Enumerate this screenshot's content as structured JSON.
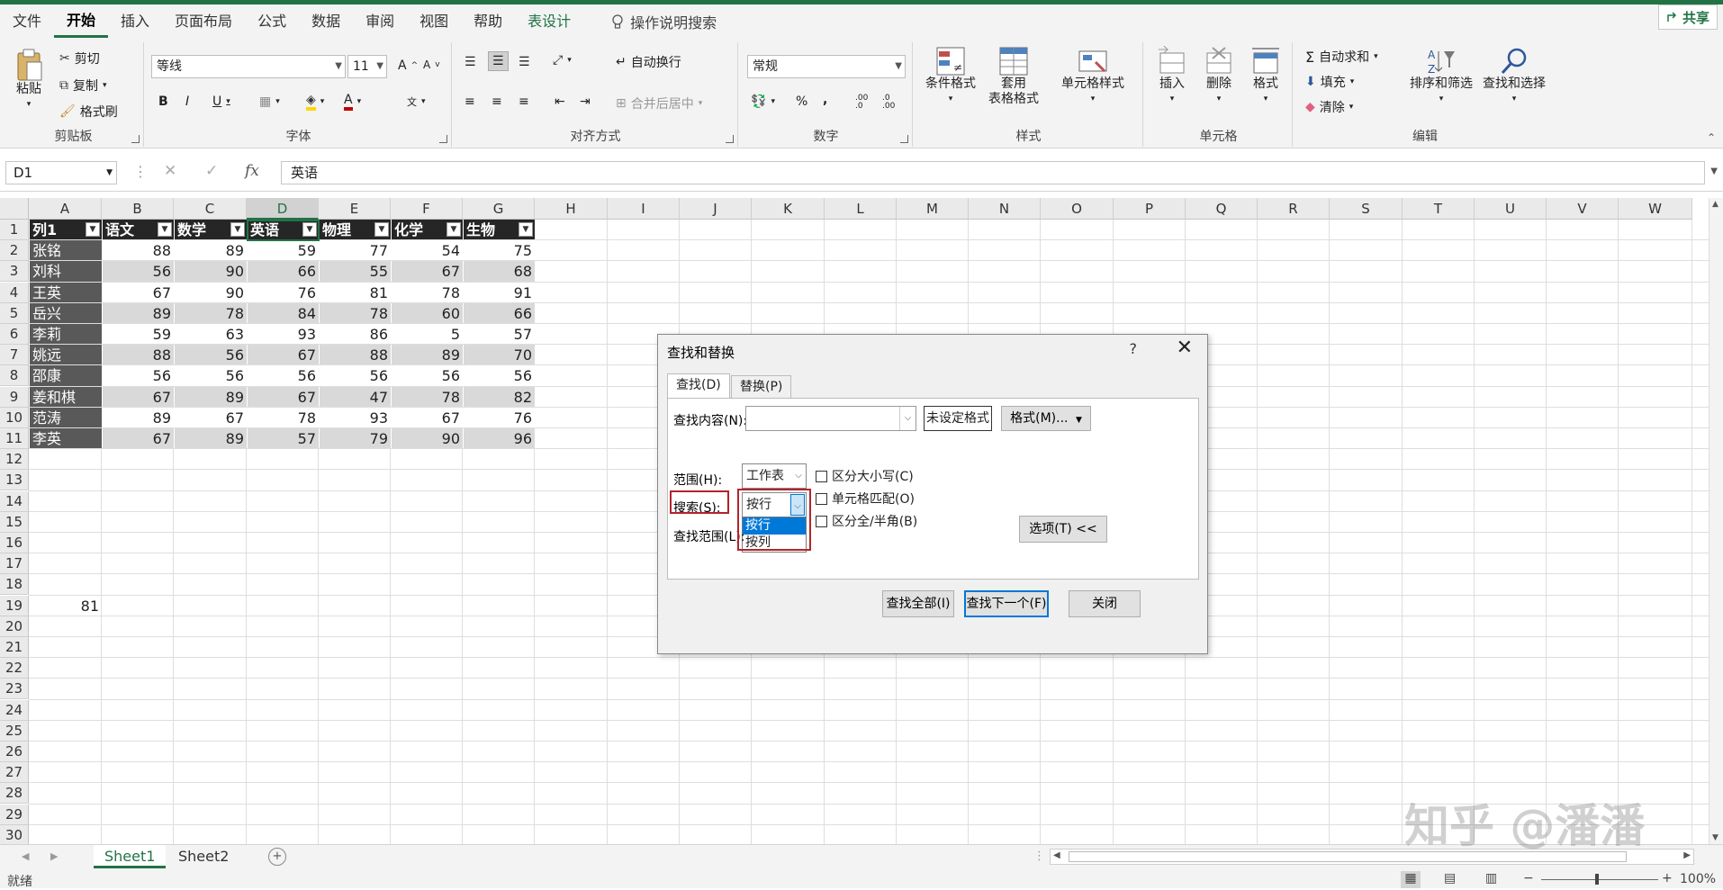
{
  "menu": {
    "items": [
      "文件",
      "开始",
      "插入",
      "页面布局",
      "公式",
      "数据",
      "审阅",
      "视图",
      "帮助",
      "表设计"
    ],
    "active": "开始",
    "tellme": "操作说明搜索",
    "share": "共享"
  },
  "ribbon": {
    "clipboard": {
      "label": "剪贴板",
      "paste": "粘贴",
      "cut": "剪切",
      "copy": "复制",
      "format_painter": "格式刷"
    },
    "font": {
      "label": "字体",
      "font_name": "等线",
      "font_size": "11",
      "bold": "B",
      "italic": "I",
      "underline": "U",
      "grow": "A",
      "shrink": "A",
      "font_color_letter": "A",
      "phonetic": "文"
    },
    "alignment": {
      "label": "对齐方式",
      "wrap": "自动换行",
      "merge": "合并后居中"
    },
    "number": {
      "label": "数字",
      "format": "常规",
      "percent": "%",
      "comma": ",",
      "inc_dec": ".00 .0",
      "dec_dec": ".0 .00"
    },
    "styles": {
      "label": "样式",
      "conditional": "条件格式",
      "table_format_1": "套用",
      "table_format_2": "表格格式",
      "cell_styles": "单元格样式"
    },
    "cells": {
      "label": "单元格",
      "insert": "插入",
      "delete": "删除",
      "format": "格式"
    },
    "editing": {
      "label": "编辑",
      "autosum": "自动求和",
      "fill": "填充",
      "clear": "清除",
      "sort": "排序和筛选",
      "find": "查找和选择"
    }
  },
  "formula_bar": {
    "name_box": "D1",
    "fx": "fx",
    "value": "英语"
  },
  "columns": [
    "A",
    "B",
    "C",
    "D",
    "E",
    "F",
    "G",
    "H",
    "I",
    "J",
    "K",
    "L",
    "M",
    "N",
    "O",
    "P",
    "Q",
    "R",
    "S",
    "T",
    "U",
    "V",
    "W"
  ],
  "selected_column": "D",
  "rows": [
    "1",
    "2",
    "3",
    "4",
    "5",
    "6",
    "7",
    "8",
    "9",
    "10",
    "11",
    "12",
    "13",
    "14",
    "15",
    "16",
    "17",
    "18",
    "19",
    "20",
    "21",
    "22",
    "23",
    "24",
    "25",
    "26",
    "27",
    "28",
    "29",
    "30"
  ],
  "table": {
    "headers": [
      "列1",
      "语文",
      "数学",
      "英语",
      "物理",
      "化学",
      "生物"
    ],
    "rows": [
      [
        "张铭",
        "88",
        "89",
        "59",
        "77",
        "54",
        "75"
      ],
      [
        "刘科",
        "56",
        "90",
        "66",
        "55",
        "67",
        "68"
      ],
      [
        "王英",
        "67",
        "90",
        "76",
        "81",
        "78",
        "91"
      ],
      [
        "岳兴",
        "89",
        "78",
        "84",
        "78",
        "60",
        "66"
      ],
      [
        "李莉",
        "59",
        "63",
        "93",
        "86",
        "5",
        "57"
      ],
      [
        "姚远",
        "88",
        "56",
        "67",
        "88",
        "89",
        "70"
      ],
      [
        "邵康",
        "56",
        "56",
        "56",
        "56",
        "56",
        "56"
      ],
      [
        "姜和棋",
        "67",
        "89",
        "67",
        "47",
        "78",
        "82"
      ],
      [
        "范涛",
        "89",
        "67",
        "78",
        "93",
        "67",
        "76"
      ],
      [
        "李英",
        "67",
        "89",
        "57",
        "79",
        "90",
        "96"
      ]
    ]
  },
  "extra_cell": {
    "ref": "A19",
    "value": "81"
  },
  "dialog": {
    "title": "查找和替换",
    "help": "?",
    "close": "✕",
    "tabs": [
      "查找(D)",
      "替换(P)"
    ],
    "find_label": "查找内容(N):",
    "find_value": "",
    "no_format": "未设定格式",
    "format_btn": "格式(M)...",
    "within_label": "范围(H):",
    "within_value": "工作表",
    "search_label": "搜索(S):",
    "search_value": "按行",
    "search_options": [
      "按行",
      "按列"
    ],
    "lookin_label": "查找范围(L):",
    "match_case": "区分大小写(C)",
    "match_cell": "单元格匹配(O)",
    "match_width": "区分全/半角(B)",
    "options_btn": "选项(T) <<",
    "find_all": "查找全部(I)",
    "find_next": "查找下一个(F)",
    "close_btn": "关闭"
  },
  "sheets": [
    "Sheet1",
    "Sheet2"
  ],
  "active_sheet": "Sheet1",
  "status": {
    "ready": "就绪",
    "zoom": "100%"
  },
  "watermark": "知乎 @潘潘"
}
